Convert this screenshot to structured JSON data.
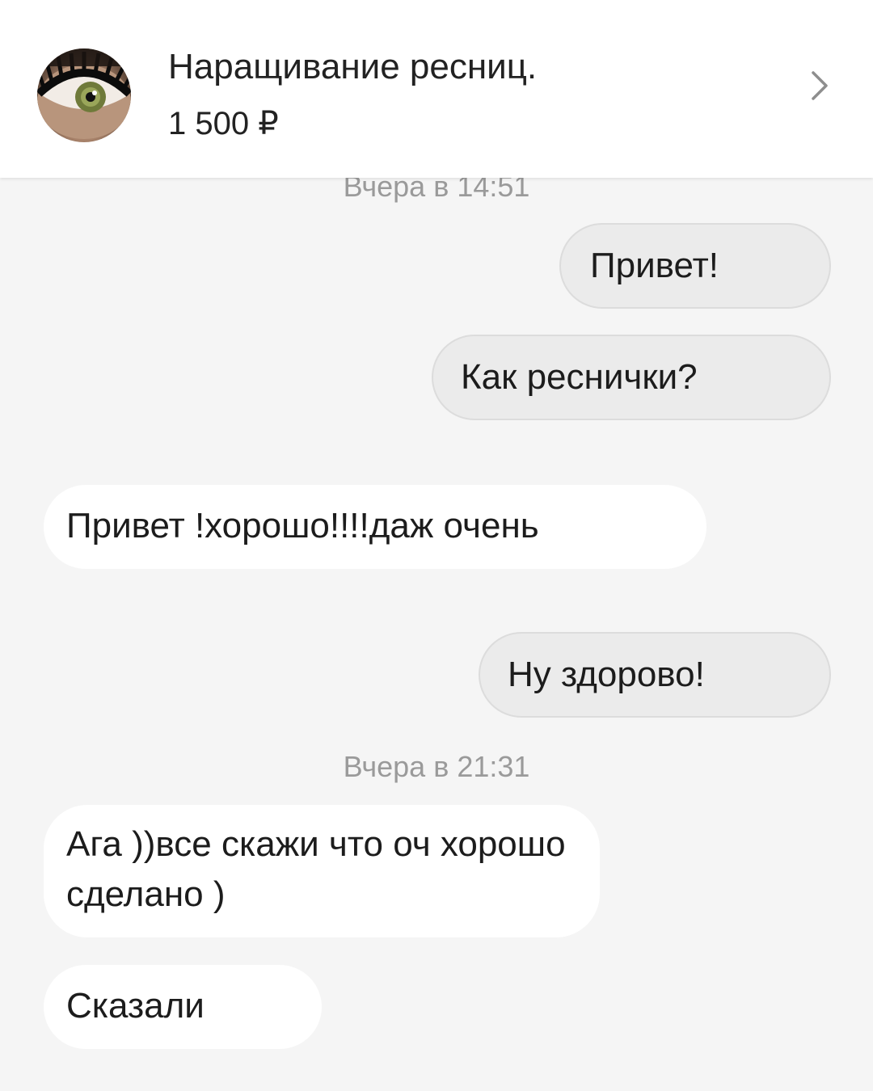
{
  "header": {
    "title": "Наращивание ресниц.",
    "price": "1 500 ₽",
    "avatar_icon": "eyelash-photo",
    "chevron_icon": "chevron-right-icon"
  },
  "chat": {
    "timestamps": [
      "Вчера в 14:51",
      "Вчера в 21:31"
    ],
    "messages": [
      {
        "direction": "outgoing",
        "text": "Привет!"
      },
      {
        "direction": "outgoing",
        "text": "Как реснички?"
      },
      {
        "direction": "incoming",
        "text": "Привет !хорошо!!!!даж очень"
      },
      {
        "direction": "outgoing",
        "text": "Ну здорово!"
      },
      {
        "direction": "incoming",
        "text": "Ага ))все скажи что оч хорошо сделано )"
      },
      {
        "direction": "incoming",
        "text": "Сказали"
      }
    ]
  },
  "colors": {
    "background": "#f5f5f5",
    "outgoing_bubble": "#ebebeb",
    "incoming_bubble": "#ffffff",
    "timestamp_text": "#9a9a9a"
  }
}
